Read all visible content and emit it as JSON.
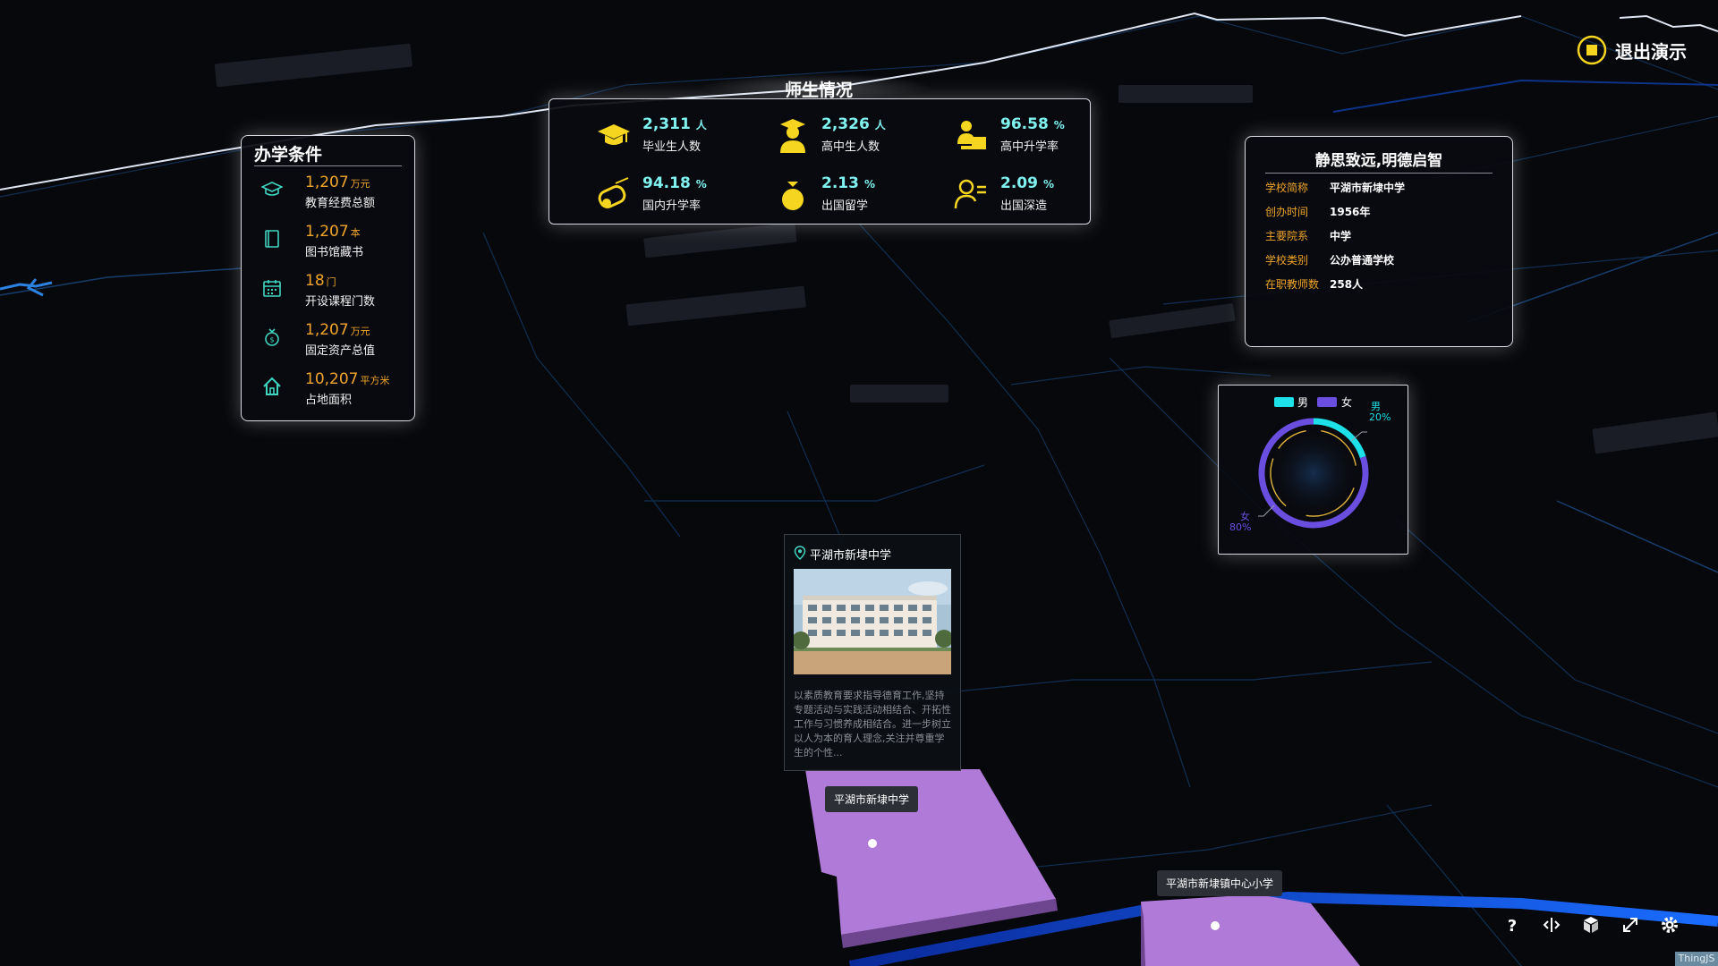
{
  "top_panel": {
    "title": "师生情况",
    "items": [
      {
        "value": "2,311",
        "unit": "人",
        "label": "毕业生人数",
        "icon": "graduation-cap-icon"
      },
      {
        "value": "2,326",
        "unit": "人",
        "label": "高中生人数",
        "icon": "student-icon"
      },
      {
        "value": "96.58",
        "unit": "%",
        "label": "高中升学率",
        "icon": "teacher-icon"
      },
      {
        "value": "94.18",
        "unit": "%",
        "label": "国内升学率",
        "icon": "diploma-icon"
      },
      {
        "value": "2.13",
        "unit": "%",
        "label": "出国留学",
        "icon": "money-bag-icon"
      },
      {
        "value": "2.09",
        "unit": "%",
        "label": "出国深造",
        "icon": "person-list-icon"
      }
    ]
  },
  "conditions_panel": {
    "title": "办学条件",
    "items": [
      {
        "value": "1,207",
        "unit": "万元",
        "label": "教育经费总额",
        "icon": "graduation-cap-icon"
      },
      {
        "value": "1,207",
        "unit": "本",
        "label": "图书馆藏书",
        "icon": "book-icon"
      },
      {
        "value": "18",
        "unit": "门",
        "label": "开设课程门数",
        "icon": "calendar-icon"
      },
      {
        "value": "1,207",
        "unit": "万元",
        "label": "固定资产总值",
        "icon": "money-bag-icon"
      },
      {
        "value": "10,207",
        "unit": "平方米",
        "label": "占地面积",
        "icon": "home-icon"
      }
    ]
  },
  "info_panel": {
    "title": "静思致远,明德启智",
    "rows": [
      {
        "key": "学校简称",
        "value": "平湖市新埭中学"
      },
      {
        "key": "创办时间",
        "value": "1956年"
      },
      {
        "key": "主要院系",
        "value": "中学"
      },
      {
        "key": "学校类别",
        "value": "公办普通学校"
      },
      {
        "key": "在职教师数",
        "value": "258人"
      }
    ]
  },
  "chart_data": {
    "type": "pie",
    "legend": [
      "男",
      "女"
    ],
    "categories": [
      "男",
      "女"
    ],
    "values": [
      20,
      80
    ],
    "labels": [
      "男",
      "20%",
      "女",
      "80%"
    ],
    "colors": {
      "男": "#1ee0e8",
      "女": "#6a4ee0"
    }
  },
  "popup": {
    "title": "平湖市新埭中学",
    "description": "以素质教育要求指导德育工作,坚持专题活动与实践活动相结合、开拓性工作与习惯养成相结合。进一步树立以人为本的育人理念,关注并尊重学生的个性..."
  },
  "map_tags": [
    "平湖市新埭中学",
    "平湖市新埭镇中心小学"
  ],
  "exit_button": {
    "label": "退出演示"
  },
  "toolbar": [
    "help-icon",
    "orbit-icon",
    "cube-icon",
    "fullscreen-icon",
    "settings-icon"
  ],
  "brand": "ThingJS",
  "colors": {
    "accent": "#7ff2ef",
    "orange": "#f0a52a",
    "icon_yellow": "#f5d51f",
    "region": "#b07ad8",
    "road": "#1556e0"
  }
}
